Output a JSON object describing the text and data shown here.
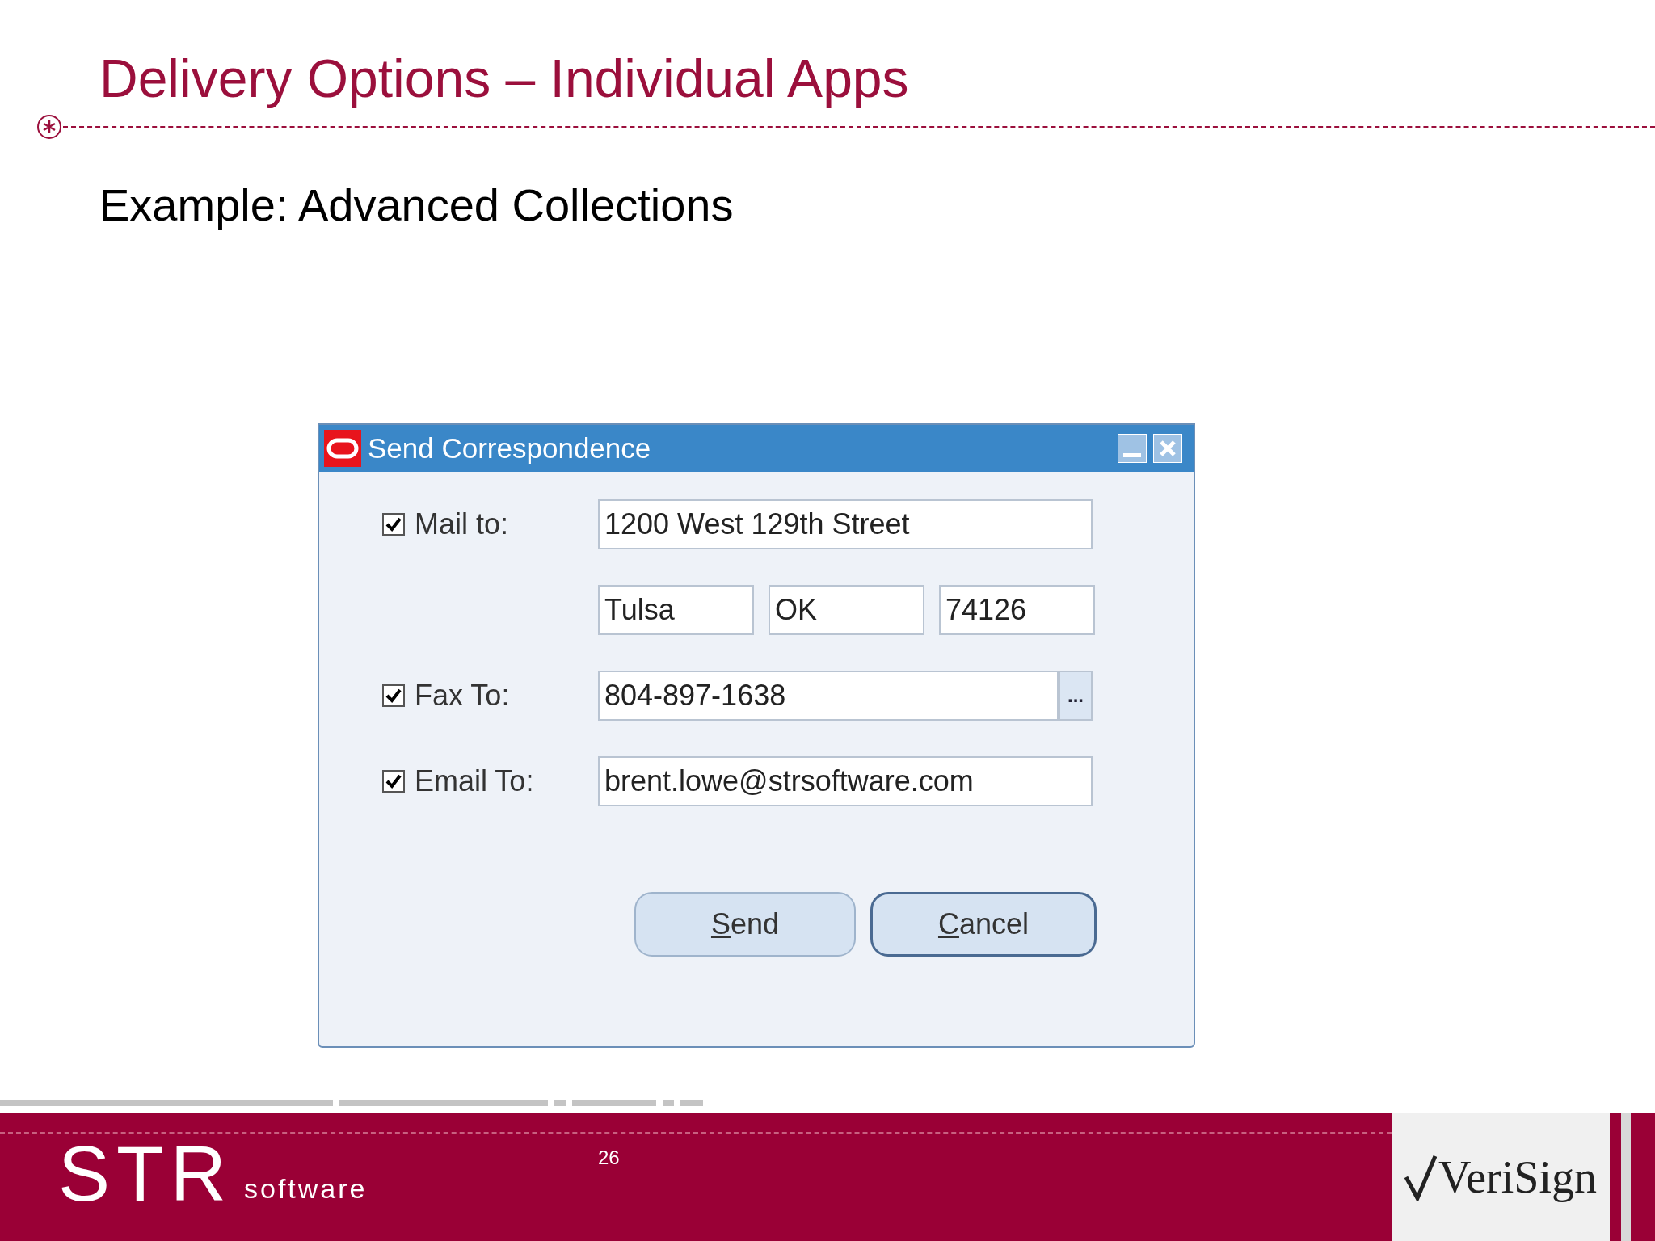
{
  "slide": {
    "title": "Delivery Options – Individual Apps",
    "subtitle": "Example: Advanced Collections",
    "page_number": "26"
  },
  "dialog": {
    "title": "Send Correspondence",
    "rows": [
      {
        "kind": "field",
        "label": "Mail to:",
        "checked": true,
        "value": "1200 West 129th Street"
      },
      {
        "kind": "split",
        "values": [
          "Tulsa",
          "OK",
          "74126"
        ]
      },
      {
        "kind": "lookup",
        "label": "Fax To:",
        "checked": true,
        "value": "804-897-1638",
        "lookup_button": "..."
      },
      {
        "kind": "field",
        "label": "Email To:",
        "checked": true,
        "value": "brent.lowe@strsoftware.com"
      }
    ],
    "buttons": [
      {
        "mnemonic": "S",
        "label_rest": "end",
        "focused": false
      },
      {
        "mnemonic": "C",
        "label_rest": "ancel",
        "focused": true
      }
    ]
  },
  "footer": {
    "logo": "STR",
    "logo_subtitle": "software",
    "partner_logo": "VeriSign"
  }
}
